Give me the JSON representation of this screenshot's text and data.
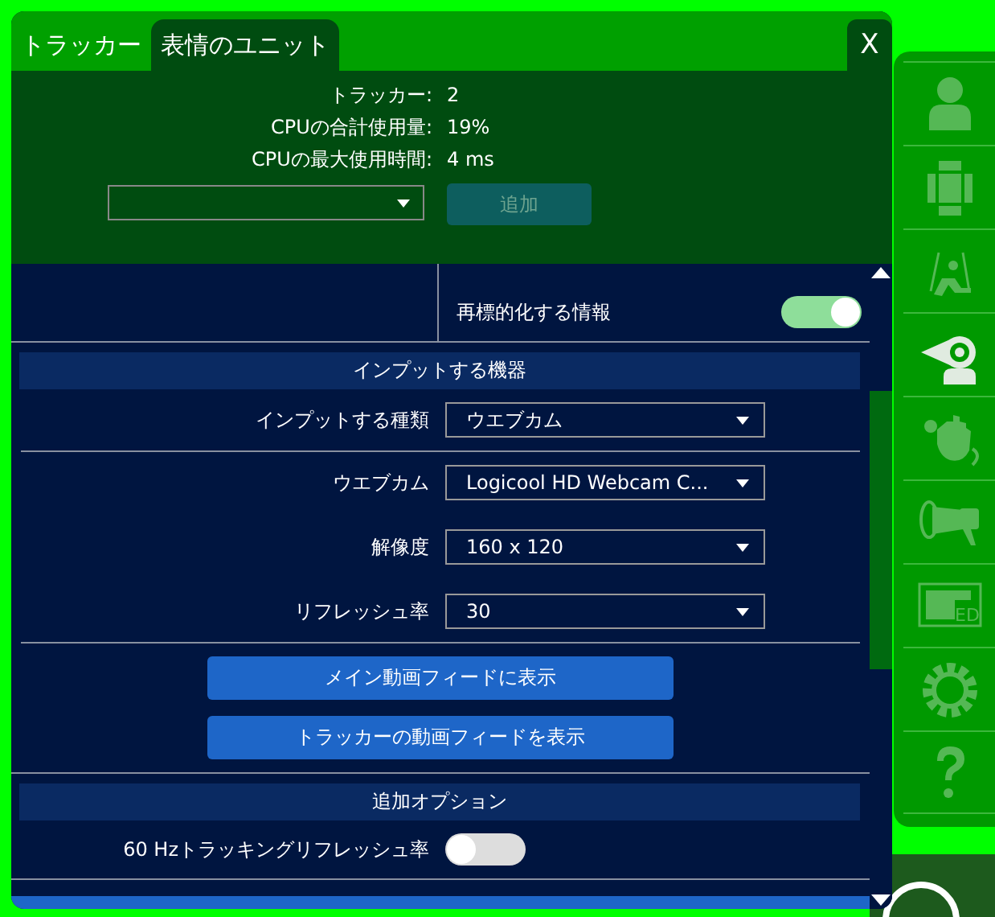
{
  "tabs": [
    {
      "label": "トラッカー",
      "selected": false
    },
    {
      "label": "表情のユニット",
      "selected": true
    }
  ],
  "close_button": "X",
  "stats": [
    {
      "label": "トラッカー:",
      "value": "2"
    },
    {
      "label": "CPUの合計使用量:",
      "value": "19%"
    },
    {
      "label": "CPUの最大使用時間:",
      "value": "4 ms"
    }
  ],
  "add_button": {
    "label": "追加",
    "disabled": true
  },
  "top_rows": [
    {
      "label": "再標的化する情報",
      "on": true
    }
  ],
  "sections": [
    {
      "title": "インプットする機器",
      "groups": [
        [
          {
            "kind": "select",
            "label": "インプットする種類",
            "value": "ウエブカム"
          }
        ],
        [
          {
            "kind": "select",
            "label": "ウエブカム",
            "value": "Logicool HD Webcam C..."
          },
          {
            "kind": "select",
            "label": "解像度",
            "value": "160 x 120"
          },
          {
            "kind": "select",
            "label": "リフレッシュ率",
            "value": "30"
          }
        ],
        [
          {
            "kind": "button",
            "label": "メイン動画フィードに表示"
          },
          {
            "kind": "button",
            "label": "トラッカーの動画フィードを表示"
          }
        ]
      ]
    },
    {
      "title": "追加オプション",
      "groups": [
        [
          {
            "kind": "toggle",
            "label": "60 Hzトラッキングリフレッシュ率",
            "on": false
          }
        ]
      ]
    }
  ],
  "sidebar": [
    {
      "selected": false
    },
    {
      "selected": false
    },
    {
      "selected": false
    },
    {
      "selected": true
    },
    {
      "selected": false
    },
    {
      "selected": false
    },
    {
      "text": "ED",
      "selected": false
    },
    {
      "selected": false
    },
    {
      "selected": false
    }
  ]
}
